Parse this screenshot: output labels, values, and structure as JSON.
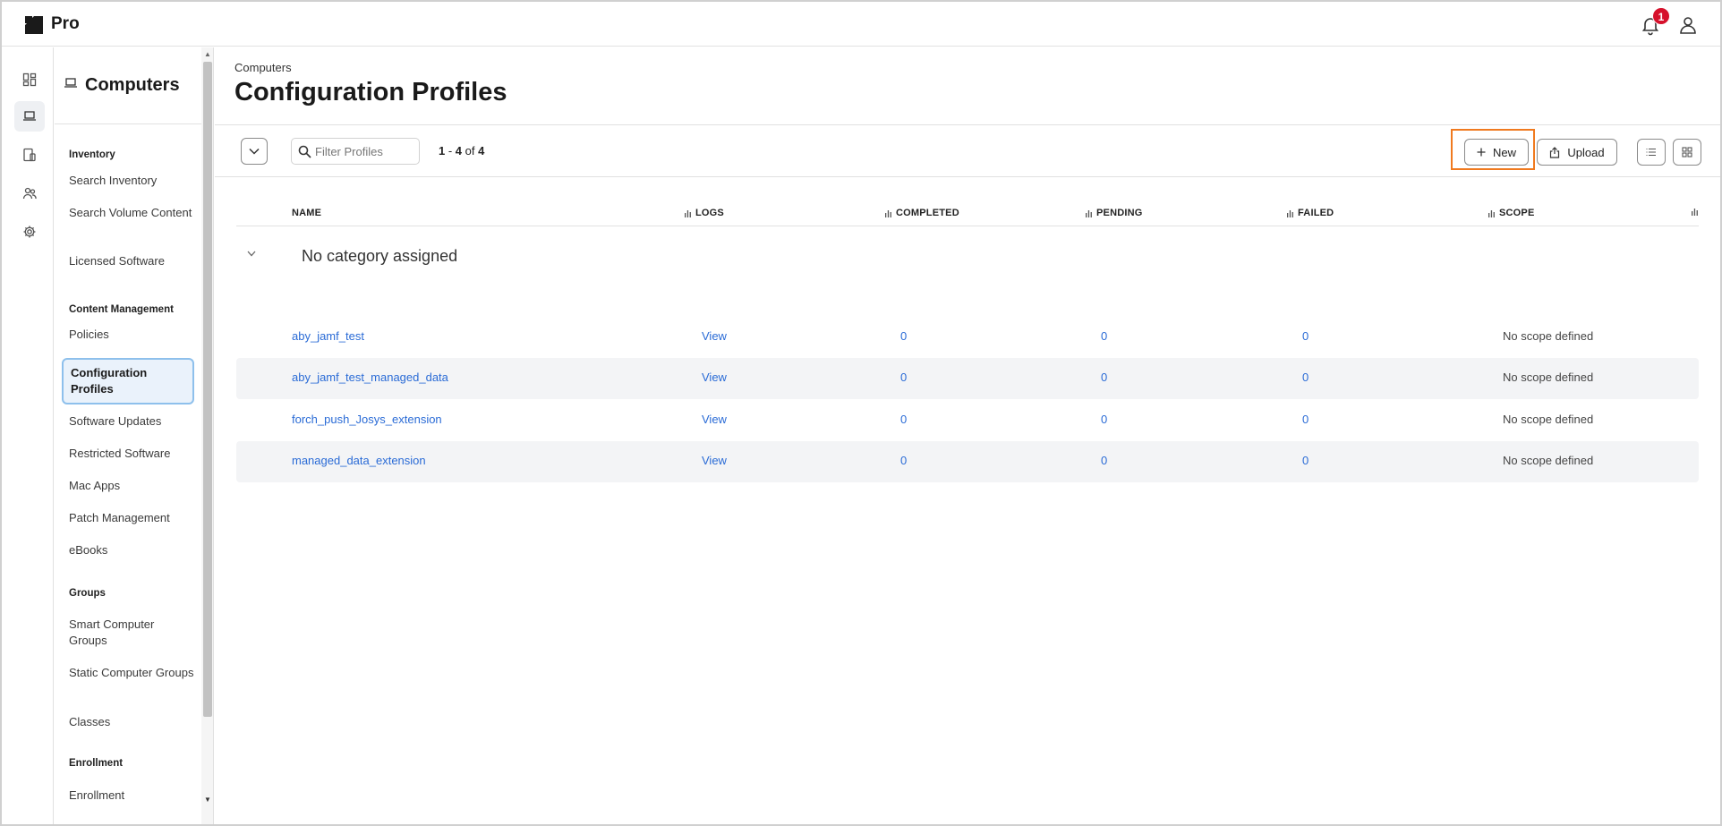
{
  "app": {
    "brand": "Pro",
    "notification_count": "1"
  },
  "sidebar": {
    "title": "Computers",
    "sections": {
      "inventory": "Inventory",
      "content_management": "Content Management",
      "groups": "Groups",
      "enrollment": "Enrollment"
    },
    "items": {
      "search_inventory": "Search Inventory",
      "search_volume_content": "Search Volume Content",
      "licensed_software": "Licensed Software",
      "policies": "Policies",
      "configuration_profiles": "Configuration Profiles",
      "software_updates": "Software Updates",
      "restricted_software": "Restricted Software",
      "mac_apps": "Mac Apps",
      "patch_management": "Patch Management",
      "ebooks": "eBooks",
      "smart_computer_groups": "Smart Computer Groups",
      "static_computer_groups": "Static Computer Groups",
      "classes": "Classes",
      "enrollment": "Enrollment"
    }
  },
  "main": {
    "breadcrumb": "Computers",
    "title": "Configuration Profiles",
    "filter_placeholder": "Filter Profiles",
    "count": {
      "start": "1",
      "sep": " - ",
      "end": "4",
      "of": " of ",
      "total": "4"
    },
    "new_label": "New",
    "upload_label": "Upload"
  },
  "table": {
    "columns": [
      "NAME",
      "LOGS",
      "COMPLETED",
      "PENDING",
      "FAILED",
      "SCOPE"
    ],
    "group_label": "No category assigned",
    "rows": [
      {
        "name": "aby_jamf_test",
        "logs": "View",
        "completed": "0",
        "pending": "0",
        "failed": "0",
        "scope": "No scope defined"
      },
      {
        "name": "aby_jamf_test_managed_data",
        "logs": "View",
        "completed": "0",
        "pending": "0",
        "failed": "0",
        "scope": "No scope defined"
      },
      {
        "name": "forch_push_Josys_extension",
        "logs": "View",
        "completed": "0",
        "pending": "0",
        "failed": "0",
        "scope": "No scope defined"
      },
      {
        "name": "managed_data_extension",
        "logs": "View",
        "completed": "0",
        "pending": "0",
        "failed": "0",
        "scope": "No scope defined"
      }
    ]
  },
  "colors": {
    "accent_link": "#2a6bd6",
    "badge": "#d6112c",
    "highlight": "#f07a1f",
    "active_item_bg": "#eaf2fb"
  },
  "icons": [
    "jamf-logo-icon",
    "bell-icon",
    "user-icon",
    "dashboard-icon",
    "laptop-icon",
    "devices-icon",
    "users-icon",
    "gear-icon",
    "search-icon",
    "chevron-down-icon",
    "plus-icon",
    "upload-icon",
    "list-view-icon",
    "grid-view-icon",
    "sort-icon"
  ]
}
